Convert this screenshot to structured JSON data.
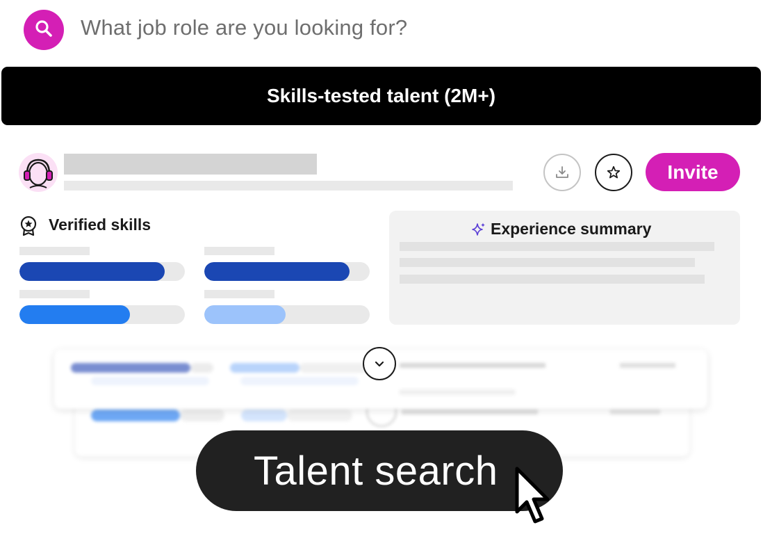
{
  "search": {
    "placeholder": "What job role are you looking for?",
    "icon": "search-icon"
  },
  "banner": {
    "title": "Skills-tested talent (2M+)"
  },
  "candidate": {
    "avatar_icon": "headphones-avatar-icon",
    "actions": {
      "download_icon": "download-icon",
      "favorite_icon": "star-icon",
      "invite_label": "Invite"
    }
  },
  "verified_skills": {
    "title": "Verified skills",
    "icon": "badge-star-icon",
    "bars": [
      {
        "level": 0.88,
        "color": "#1b47b3"
      },
      {
        "level": 0.88,
        "color": "#1b47b3"
      },
      {
        "level": 0.67,
        "color": "#237df0"
      },
      {
        "level": 0.49,
        "color": "#9cc3fb"
      }
    ]
  },
  "experience_summary": {
    "title": "Experience summary",
    "icon": "sparkle-icon"
  },
  "expand": {
    "icon": "chevron-down-icon"
  },
  "cta": {
    "label": "Talent search",
    "cursor_icon": "pointer-cursor-icon"
  },
  "colors": {
    "brand": "#d41fb5",
    "banner_bg": "#000000",
    "pill_bg": "#212121",
    "skill_dark": "#1b47b3",
    "skill_mid": "#237df0",
    "skill_light": "#9cc3fb",
    "sparkle": "#5b3fd6"
  }
}
